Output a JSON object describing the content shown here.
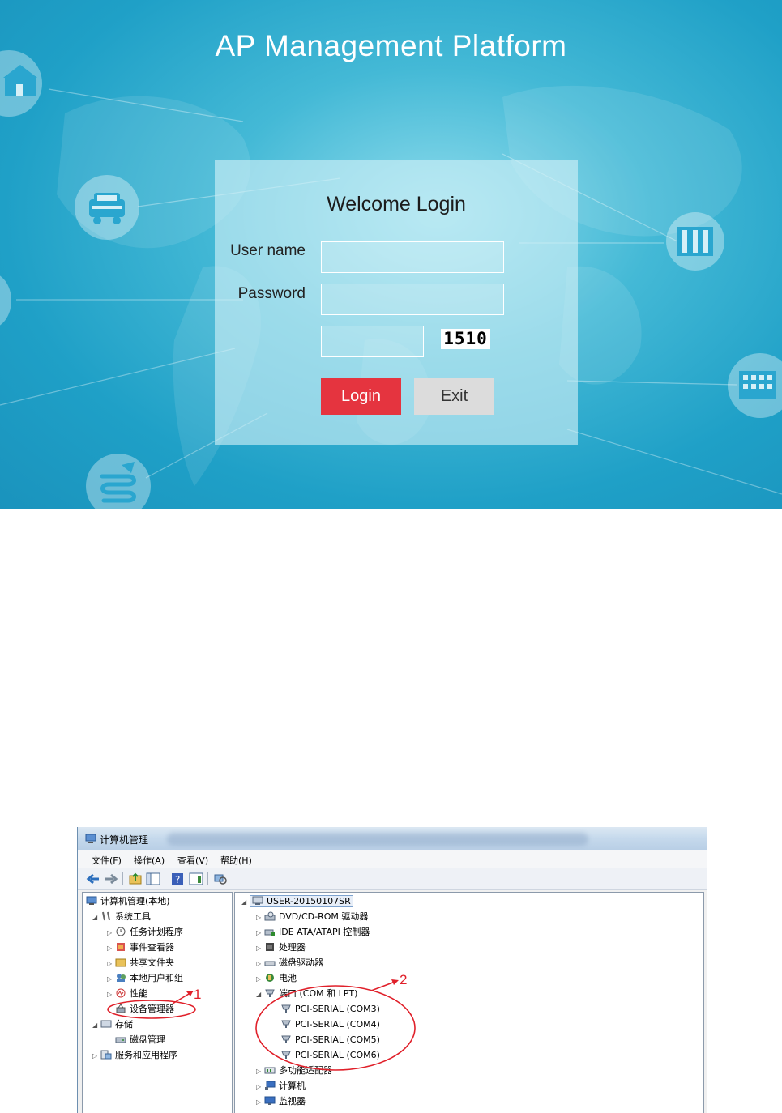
{
  "login_screen": {
    "platform_title": "AP Management Platform",
    "welcome_title": "Welcome Login",
    "username_label": "User name",
    "username_value": "",
    "password_label": "Password",
    "password_value": "",
    "captcha_value": "",
    "captcha_code": "1510",
    "login_button": "Login",
    "exit_button": "Exit",
    "icons": [
      "school-icon",
      "car-icon",
      "building-icon",
      "office-building-icon",
      "road-icon"
    ],
    "colors": {
      "login_button": "#e5343f",
      "exit_button": "#dcdcdc",
      "background": "#1fa0c7"
    }
  },
  "mgmt_window": {
    "title": "计算机管理",
    "menu": [
      "文件(F)",
      "操作(A)",
      "查看(V)",
      "帮助(H)"
    ],
    "left_tree": [
      {
        "label": "计算机管理(本地)",
        "icon": "computer-mgmt-icon"
      },
      {
        "label": "系统工具",
        "icon": "tools-icon"
      },
      {
        "label": "任务计划程序",
        "icon": "clock-icon"
      },
      {
        "label": "事件查看器",
        "icon": "event-viewer-icon"
      },
      {
        "label": "共享文件夹",
        "icon": "shared-folder-icon"
      },
      {
        "label": "本地用户和组",
        "icon": "users-icon"
      },
      {
        "label": "性能",
        "icon": "performance-icon"
      },
      {
        "label": "设备管理器",
        "icon": "device-manager-icon"
      },
      {
        "label": "存储",
        "icon": "storage-icon"
      },
      {
        "label": "磁盘管理",
        "icon": "disk-mgmt-icon"
      },
      {
        "label": "服务和应用程序",
        "icon": "services-icon"
      }
    ],
    "right_tree": [
      {
        "label": "USER-20150107SR",
        "icon": "computer-icon"
      },
      {
        "label": "DVD/CD-ROM 驱动器",
        "icon": "dvd-icon"
      },
      {
        "label": "IDE ATA/ATAPI 控制器",
        "icon": "ide-icon"
      },
      {
        "label": "处理器",
        "icon": "cpu-icon"
      },
      {
        "label": "磁盘驱动器",
        "icon": "disk-icon"
      },
      {
        "label": "电池",
        "icon": "battery-icon"
      },
      {
        "label": "端口 (COM 和 LPT)",
        "icon": "port-icon"
      },
      {
        "label": "PCI-SERIAL (COM3)",
        "icon": "serial-port-icon"
      },
      {
        "label": "PCI-SERIAL (COM4)",
        "icon": "serial-port-icon"
      },
      {
        "label": "PCI-SERIAL (COM5)",
        "icon": "serial-port-icon"
      },
      {
        "label": "PCI-SERIAL (COM6)",
        "icon": "serial-port-icon"
      },
      {
        "label": "多功能适配器",
        "icon": "adapter-icon"
      },
      {
        "label": "计算机",
        "icon": "computer-icon"
      },
      {
        "label": "监视器",
        "icon": "monitor-icon"
      }
    ],
    "annotations": [
      "1",
      "2"
    ],
    "annotation_color": "#e0202a"
  }
}
